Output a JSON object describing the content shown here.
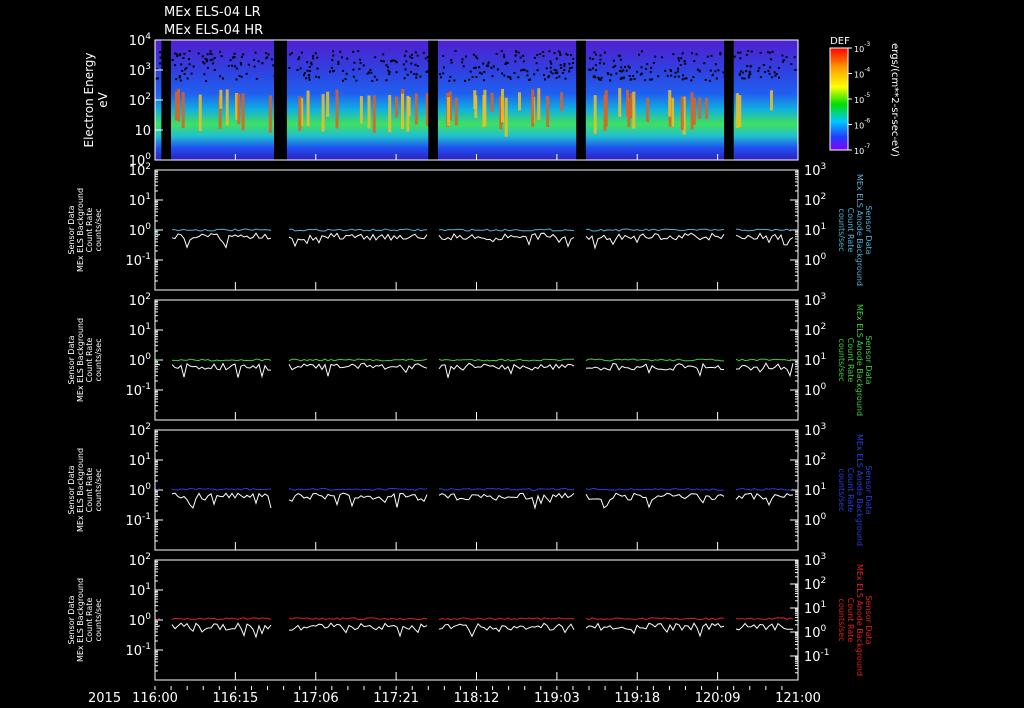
{
  "titles": [
    "MEx ELS-04 LR",
    "MEx ELS-04 HR"
  ],
  "year_label": "2015",
  "x_tick_labels": [
    "116:00",
    "116:15",
    "117:06",
    "117:21",
    "118:12",
    "119:03",
    "119:18",
    "120:09",
    "121:00"
  ],
  "spectrogram": {
    "ylabel": [
      "Electron Energy",
      "eV"
    ],
    "y_ticks": [
      {
        "base": "10",
        "exp": "4"
      },
      {
        "base": "10",
        "exp": "3"
      },
      {
        "base": "10",
        "exp": "2"
      },
      {
        "base": "10",
        "exp": ""
      },
      {
        "base": "10",
        "exp": "0"
      }
    ],
    "colorbar_title": "DEF",
    "colorbar_ticks": [
      "-3",
      "-4",
      "-5",
      "-6",
      "-7"
    ],
    "colorbar_label": "ergs/(cm**2-sr-sec-eV)",
    "data_gaps": [
      [
        0.01,
        0.025
      ],
      [
        0.185,
        0.205
      ],
      [
        0.425,
        0.44
      ],
      [
        0.655,
        0.67
      ],
      [
        0.885,
        0.9
      ]
    ]
  },
  "chart_data": [
    {
      "type": "line",
      "left_ylabel": [
        "Sensor Data",
        "MEx ELS Background",
        "Count Rate",
        "counts/sec"
      ],
      "right_ylabel": [
        "Sensor Data",
        "MEx ELS Anode Background",
        "Count Rate",
        "counts/sec"
      ],
      "left_ylim": [
        0.01,
        100
      ],
      "right_ylim": [
        0.1,
        1000
      ],
      "series": [
        {
          "color": "#4fb3d9",
          "level_left": 1.0
        },
        {
          "color": "#ffffff",
          "level_left": 0.6
        }
      ],
      "left_ticks": [
        {
          "b": "10",
          "e": "2"
        },
        {
          "b": "10",
          "e": "1"
        },
        {
          "b": "10",
          "e": "0"
        },
        {
          "b": "10",
          "e": "-1"
        }
      ],
      "right_ticks": [
        {
          "b": "10",
          "e": "3"
        },
        {
          "b": "10",
          "e": "2"
        },
        {
          "b": "10",
          "e": "1"
        },
        {
          "b": "10",
          "e": "0"
        }
      ]
    },
    {
      "type": "line",
      "left_ylabel": [
        "Sensor Data",
        "MEx ELS Background",
        "Count Rate",
        "counts/sec"
      ],
      "right_ylabel": [
        "Sensor Data",
        "MEx ELS Anode Background",
        "Count Rate",
        "counts/sec"
      ],
      "left_ylim": [
        0.01,
        100
      ],
      "right_ylim": [
        0.1,
        1000
      ],
      "series": [
        {
          "color": "#3ecf3e",
          "level_left": 1.0
        },
        {
          "color": "#ffffff",
          "level_left": 0.6
        }
      ],
      "left_ticks": [
        {
          "b": "10",
          "e": "2"
        },
        {
          "b": "10",
          "e": "1"
        },
        {
          "b": "10",
          "e": "0"
        },
        {
          "b": "10",
          "e": "-1"
        }
      ],
      "right_ticks": [
        {
          "b": "10",
          "e": "3"
        },
        {
          "b": "10",
          "e": "2"
        },
        {
          "b": "10",
          "e": "1"
        },
        {
          "b": "10",
          "e": "0"
        }
      ]
    },
    {
      "type": "line",
      "left_ylabel": [
        "Sensor Data",
        "MEx ELS Background",
        "Count Rate",
        "counts/sec"
      ],
      "right_ylabel": [
        "Sensor Data",
        "MEx ELS Anode Background",
        "Count Rate",
        "counts/sec"
      ],
      "left_ylim": [
        0.01,
        100
      ],
      "right_ylim": [
        0.1,
        1000
      ],
      "series": [
        {
          "color": "#2a3de0",
          "level_left": 1.05
        },
        {
          "color": "#ffffff",
          "level_left": 0.6
        }
      ],
      "left_ticks": [
        {
          "b": "10",
          "e": "2"
        },
        {
          "b": "10",
          "e": "1"
        },
        {
          "b": "10",
          "e": "0"
        },
        {
          "b": "10",
          "e": "-1"
        }
      ],
      "right_ticks": [
        {
          "b": "10",
          "e": "3"
        },
        {
          "b": "10",
          "e": "2"
        },
        {
          "b": "10",
          "e": "1"
        },
        {
          "b": "10",
          "e": "0"
        }
      ]
    },
    {
      "type": "line",
      "left_ylabel": [
        "Sensor Data",
        "MEx ELS Background",
        "Count Rate",
        "counts/sec"
      ],
      "right_ylabel": [
        "Sensor Data",
        "MEx ELS Anode Background",
        "Count Rate",
        "counts/sec"
      ],
      "left_ylim": [
        0.01,
        100
      ],
      "right_ylim": [
        0.01,
        1000
      ],
      "series": [
        {
          "color": "#e02020",
          "level_left": 1.1
        },
        {
          "color": "#ffffff",
          "level_left": 0.6
        }
      ],
      "left_ticks": [
        {
          "b": "10",
          "e": "2"
        },
        {
          "b": "10",
          "e": "1"
        },
        {
          "b": "10",
          "e": "0"
        },
        {
          "b": "10",
          "e": "-1"
        }
      ],
      "right_ticks": [
        {
          "b": "10",
          "e": "3"
        },
        {
          "b": "10",
          "e": "2"
        },
        {
          "b": "10",
          "e": "1"
        },
        {
          "b": "10",
          "e": "0"
        },
        {
          "b": "10",
          "e": "-1"
        }
      ]
    }
  ]
}
